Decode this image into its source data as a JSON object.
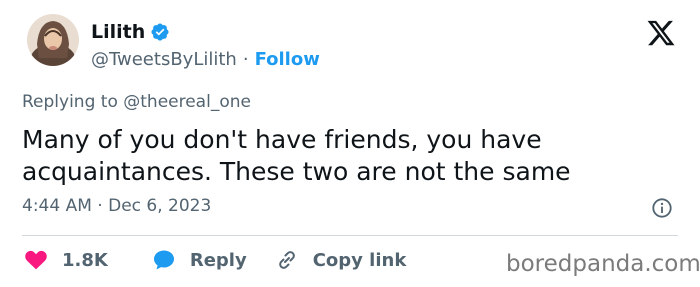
{
  "author": {
    "display_name": "Lilith",
    "handle": "@TweetsByLilith",
    "separator": "·",
    "follow_label": "Follow",
    "verified": true
  },
  "tweet": {
    "replying_prefix": "Replying to ",
    "replying_handle": "@theereal_one",
    "text_lines": [
      "Many of you don't have friends, you have",
      "acquaintances. These two are not the same"
    ],
    "time": "4:44 AM",
    "meta_separator": "·",
    "date": "Dec 6, 2023"
  },
  "actions": {
    "likes_count": "1.8K",
    "reply_label": "Reply",
    "copy_link_label": "Copy link"
  },
  "icons": {
    "verified": "verified-badge-icon",
    "platform": "x-logo-icon",
    "info": "info-icon",
    "like": "heart-icon",
    "reply": "speech-bubble-icon",
    "copy": "link-icon"
  },
  "colors": {
    "accent": "#1d9bf0",
    "like": "#f91880",
    "text": "#0f1419",
    "muted": "#536471",
    "divider": "#cfd9de",
    "watermark": "#7b7b7b"
  },
  "watermark": {
    "text": "boredpanda.com"
  }
}
